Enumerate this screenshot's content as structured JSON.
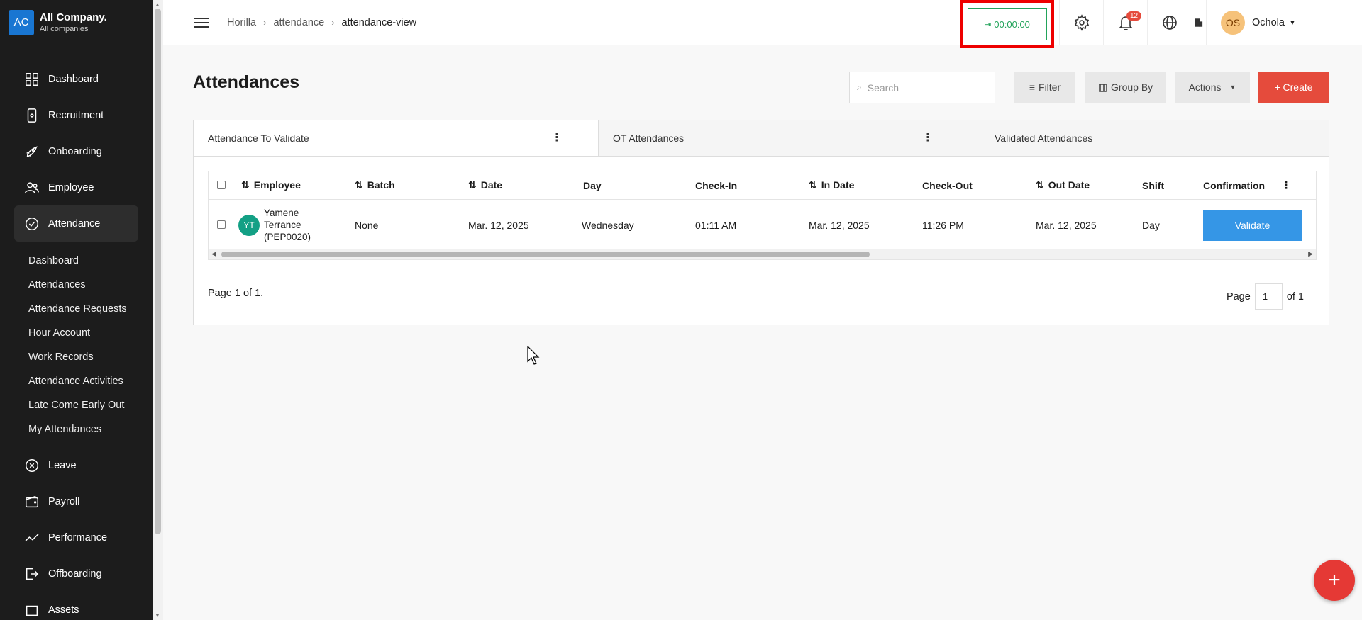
{
  "company": {
    "initials": "AC",
    "name": "All Company.",
    "subtitle": "All companies"
  },
  "sidebar": {
    "items": [
      {
        "label": "Dashboard",
        "icon": "grid-icon"
      },
      {
        "label": "Recruitment",
        "icon": "phone-icon"
      },
      {
        "label": "Onboarding",
        "icon": "rocket-icon"
      },
      {
        "label": "Employee",
        "icon": "users-icon"
      },
      {
        "label": "Attendance",
        "icon": "check-circle-icon"
      },
      {
        "label": "Leave",
        "icon": "x-circle-icon"
      },
      {
        "label": "Payroll",
        "icon": "wallet-icon"
      },
      {
        "label": "Performance",
        "icon": "trend-icon"
      },
      {
        "label": "Offboarding",
        "icon": "exit-icon"
      },
      {
        "label": "Assets",
        "icon": "box-icon"
      }
    ],
    "attendance_sub": [
      "Dashboard",
      "Attendances",
      "Attendance Requests",
      "Hour Account",
      "Work Records",
      "Attendance Activities",
      "Late Come Early Out",
      "My Attendances"
    ]
  },
  "topbar": {
    "breadcrumbs": [
      "Horilla",
      "attendance",
      "attendance-view"
    ],
    "clock": "00:00:00",
    "notifications_count": "12",
    "user_initials": "OS",
    "user_name": "Ochola"
  },
  "page": {
    "title": "Attendances",
    "search_placeholder": "Search",
    "filter_label": "Filter",
    "groupby_label": "Group By",
    "actions_label": "Actions",
    "create_label": "+ Create"
  },
  "tabs": [
    {
      "label": "Attendance To Validate"
    },
    {
      "label": "OT Attendances"
    },
    {
      "label": "Validated Attendances"
    }
  ],
  "table": {
    "headers": [
      "Employee",
      "Batch",
      "Date",
      "Day",
      "Check-In",
      "In Date",
      "Check-Out",
      "Out Date",
      "Shift",
      "Confirmation"
    ],
    "rows": [
      {
        "initials": "YT",
        "employee": "Yamene Terrance (PEP0020)",
        "batch": "None",
        "date": "Mar. 12, 2025",
        "day": "Wednesday",
        "check_in": "01:11 AM",
        "in_date": "Mar. 12, 2025",
        "check_out": "11:26 PM",
        "out_date": "Mar. 12, 2025",
        "shift": "Day",
        "action": "Validate"
      }
    ]
  },
  "pagination": {
    "info": "Page 1 of 1.",
    "page_label": "Page",
    "current": "1",
    "of_label": "of 1"
  },
  "colors": {
    "accent": "#e54b3c",
    "validate": "#3596e6",
    "clock": "#22a35a"
  }
}
